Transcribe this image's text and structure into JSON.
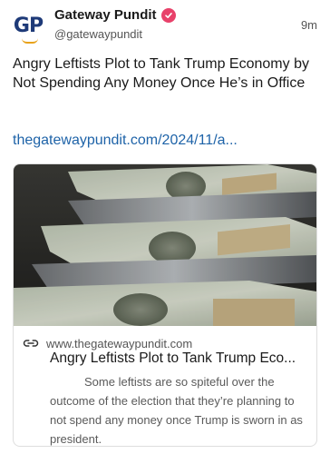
{
  "post": {
    "avatar_text": "GP",
    "display_name": "Gateway Pundit",
    "handle": "@gatewaypundit",
    "time": "9m",
    "text": "Angry Leftists Plot to Tank Trump Economy by Not Spending Any Money Once He’s in Office",
    "link": "thegatewaypundit.com/2024/11/a..."
  },
  "card": {
    "domain": "www.thegatewaypundit.com",
    "title": "Angry Leftists Plot to Tank Trump Eco...",
    "description": "Some leftists are so spiteful over the outcome of the election that they’re planning to not spend any money once Trump is sworn in as president."
  },
  "colors": {
    "link": "#1e63a8",
    "verified": "#e8416a",
    "avatar_text": "#1e3a78",
    "avatar_accent": "#e8a21a"
  },
  "icons": {
    "verified": "verified-badge-icon",
    "card_link": "link-icon"
  }
}
